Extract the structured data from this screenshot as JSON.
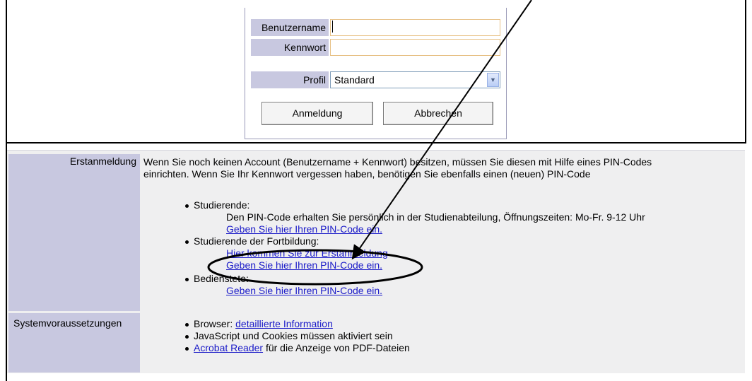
{
  "login": {
    "username_label": "Benutzername",
    "password_label": "Kennwort",
    "profile_label": "Profil",
    "profile_value": "Standard",
    "login_button": "Anmeldung",
    "cancel_button": "Abbrechen",
    "username_value": "",
    "password_value": ""
  },
  "info": {
    "first_login_label": "Erstanmeldung",
    "intro_line1": "Wenn Sie noch keinen Account (Benutzername + Kennwort) besitzen, müssen Sie diesen mit Hilfe eines PIN-Codes",
    "intro_line2": "einrichten. Wenn Sie Ihr Kennwort vergessen haben, benötigen Sie ebenfalls einen (neuen) PIN-Code",
    "items": [
      {
        "title": "Studierende:",
        "text": "Den PIN-Code erhalten Sie persönlich in der Studienabteilung, Öffnungszeiten: Mo-Fr. 9-12 Uhr",
        "link": "Geben Sie hier Ihren PIN-Code ein."
      },
      {
        "title": "Studierende der Fortbildung:",
        "link1": "Hier kommen Sie zur Erstanmeldung",
        "link2": "Geben Sie hier Ihren PIN-Code ein."
      },
      {
        "title": "Bedienstete:",
        "link": "Geben Sie hier Ihren PIN-Code ein."
      }
    ],
    "sysreq_label": "Systemvoraussetzungen",
    "sysreq": {
      "browser_prefix": "Browser: ",
      "browser_link": "detaillierte Information",
      "js_cookies": "JavaScript und Cookies müssen aktiviert sein",
      "acrobat_link": "Acrobat Reader",
      "acrobat_suffix": " für die Anzeige von PDF-Dateien"
    }
  },
  "colors": {
    "label_bg": "#c8c8e0",
    "panel_bg": "#efeff0",
    "link": "#1a1ac8",
    "input_border": "#e7c084"
  }
}
